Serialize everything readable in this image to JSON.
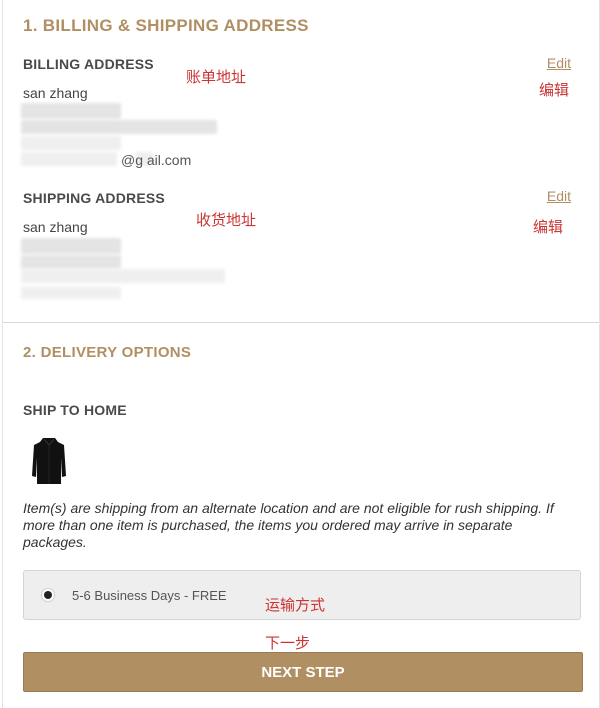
{
  "section1": {
    "title": "1. BILLING & SHIPPING ADDRESS",
    "billing": {
      "heading": "BILLING ADDRESS",
      "name": "san zhang",
      "email_partial": "@g  ail.com",
      "edit_label": "Edit",
      "annotation": "账单地址",
      "edit_annotation": "编辑"
    },
    "shipping": {
      "heading": "SHIPPING ADDRESS",
      "name": "san zhang",
      "edit_label": "Edit",
      "annotation": "收货地址",
      "edit_annotation": "编辑"
    }
  },
  "section2": {
    "title": "2. DELIVERY OPTIONS",
    "ship_heading": "SHIP TO HOME",
    "product_icon": "black-jacket",
    "note": "Item(s) are shipping from an alternate location and are not eligible for rush shipping. If more than one item is purchased, the items you ordered may arrive in separate packages.",
    "option": {
      "label": "5-6 Business Days - FREE",
      "selected": true,
      "annotation": "运输方式"
    },
    "next": {
      "label": "NEXT STEP",
      "annotation": "下一步"
    }
  },
  "colors": {
    "accent": "#b08f63",
    "annotation": "#cc3333"
  }
}
